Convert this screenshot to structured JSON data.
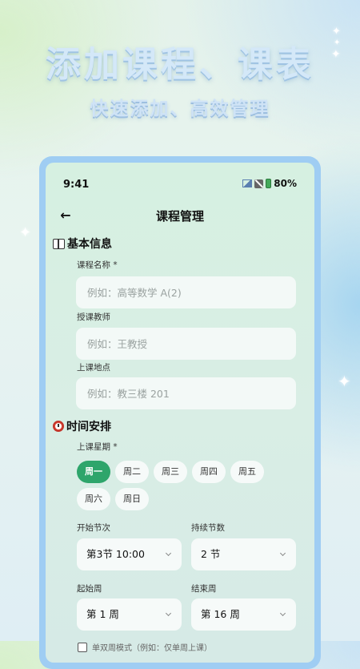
{
  "hero": {
    "title": "添加课程、课表",
    "subtitle": "快速添加、高效管理"
  },
  "status_bar": {
    "time": "9:41",
    "battery": "80%"
  },
  "app_bar": {
    "back_glyph": "←",
    "title": "课程管理"
  },
  "basic_info": {
    "title": "基本信息",
    "course_name": {
      "label": "课程名称 *",
      "placeholder": "例如：高等数学 A(2)",
      "value": ""
    },
    "teacher": {
      "label": "授课教师",
      "placeholder": "例如：王教授",
      "value": ""
    },
    "location": {
      "label": "上课地点",
      "placeholder": "例如：教三楼 201",
      "value": ""
    }
  },
  "schedule": {
    "title": "时间安排",
    "weekday_label": "上课星期 *",
    "weekdays": [
      {
        "label": "周一",
        "selected": true
      },
      {
        "label": "周二",
        "selected": false
      },
      {
        "label": "周三",
        "selected": false
      },
      {
        "label": "周四",
        "selected": false
      },
      {
        "label": "周五",
        "selected": false
      },
      {
        "label": "周六",
        "selected": false
      },
      {
        "label": "周日",
        "selected": false
      }
    ],
    "start_period": {
      "label": "开始节次",
      "value": "第3节 10:00"
    },
    "duration": {
      "label": "持续节数",
      "value": "2 节"
    },
    "start_week": {
      "label": "起始周",
      "value": "第 1 周"
    },
    "end_week": {
      "label": "结束周",
      "value": "第 16 周"
    },
    "odd_even": {
      "label": "单双周模式（例如：仅单周上课）"
    }
  },
  "colors": {
    "accent": "#2ea56b",
    "frame": "#9fcdf3"
  }
}
